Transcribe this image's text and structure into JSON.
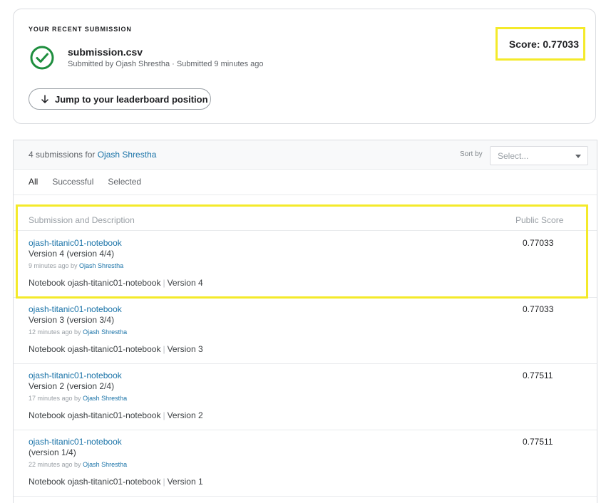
{
  "recent": {
    "label": "YOUR RECENT SUBMISSION",
    "filename": "submission.csv",
    "submitted_line": "Submitted by Ojash Shrestha · Submitted 9 minutes ago",
    "score_text": "Score: 0.77033",
    "jump_label": "Jump to your leaderboard position"
  },
  "list": {
    "count_prefix": "4 submissions for ",
    "user": "Ojash Shrestha",
    "sort_label": "Sort by",
    "sort_placeholder": "Select...",
    "tabs": [
      {
        "label": "All"
      },
      {
        "label": "Successful"
      },
      {
        "label": "Selected"
      }
    ],
    "col_submission": "Submission and Description",
    "col_score": "Public Score",
    "rows": [
      {
        "title": "ojash-titanic01-notebook",
        "version": "Version 4 (version 4/4)",
        "time": "9 minutes ago by ",
        "author": "Ojash Shrestha",
        "notebook": "Notebook ojash-titanic01-notebook",
        "nb_version": "Version 4",
        "score": "0.77033"
      },
      {
        "title": "ojash-titanic01-notebook",
        "version": "Version 3 (version 3/4)",
        "time": "12 minutes ago by ",
        "author": "Ojash Shrestha",
        "notebook": "Notebook ojash-titanic01-notebook",
        "nb_version": "Version 3",
        "score": "0.77033"
      },
      {
        "title": "ojash-titanic01-notebook",
        "version": "Version 2 (version 2/4)",
        "time": "17 minutes ago by ",
        "author": "Ojash Shrestha",
        "notebook": "Notebook ojash-titanic01-notebook",
        "nb_version": "Version 2",
        "score": "0.77511"
      },
      {
        "title": "ojash-titanic01-notebook",
        "version": "(version 1/4)",
        "time": "22 minutes ago by ",
        "author": "Ojash Shrestha",
        "notebook": "Notebook ojash-titanic01-notebook",
        "nb_version": "Version 1",
        "score": "0.77511"
      }
    ]
  },
  "colors": {
    "accent_link": "#1a73a8",
    "success": "#1e8e3e",
    "highlight": "#f4ea2a"
  }
}
